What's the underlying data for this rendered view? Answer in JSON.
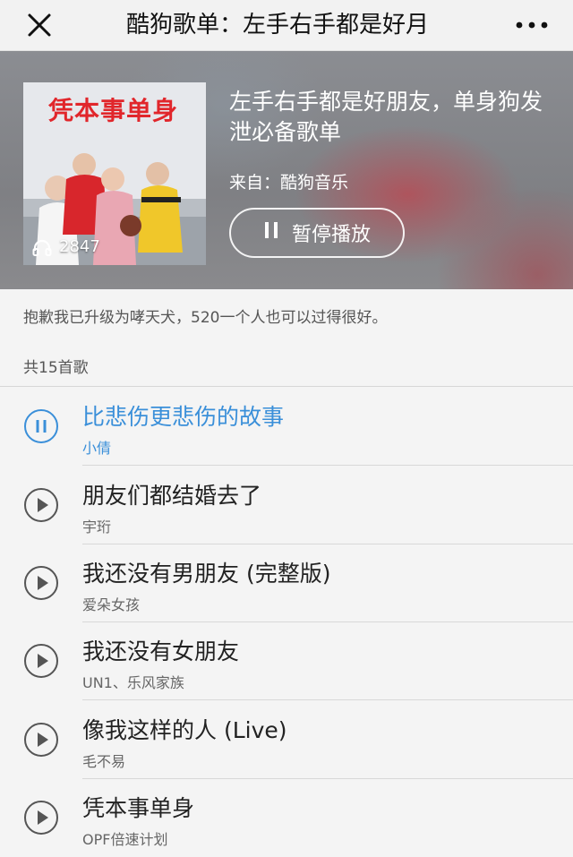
{
  "nav": {
    "title": "酷狗歌单：左手右手都是好月",
    "close_icon": "close-icon",
    "more_icon": "more-dots-icon"
  },
  "header": {
    "cover_text": "凭本事单身",
    "listen_count": "2847",
    "title": "左手右手都是好朋友，单身狗发泄必备歌单",
    "source": "来自：酷狗音乐",
    "pause_label": "暂停播放"
  },
  "description": "抱歉我已升级为哮天犬，520一个人也可以过得很好。",
  "song_count_label": "共15首歌",
  "colors": {
    "accent": "#3a8fd9",
    "play_icon": "#555555"
  },
  "songs": [
    {
      "title": "比悲伤更悲伤的故事",
      "artist": "小倩",
      "state": "playing"
    },
    {
      "title": "朋友们都结婚去了",
      "artist": "宇珩",
      "state": "stopped"
    },
    {
      "title": "我还没有男朋友 (完整版)",
      "artist": "爱朵女孩",
      "state": "stopped"
    },
    {
      "title": "我还没有女朋友",
      "artist": "UN1、乐风家族",
      "state": "stopped"
    },
    {
      "title": "像我这样的人 (Live)",
      "artist": "毛不易",
      "state": "stopped"
    },
    {
      "title": "凭本事单身",
      "artist": "OPF倍速计划",
      "state": "stopped"
    }
  ]
}
